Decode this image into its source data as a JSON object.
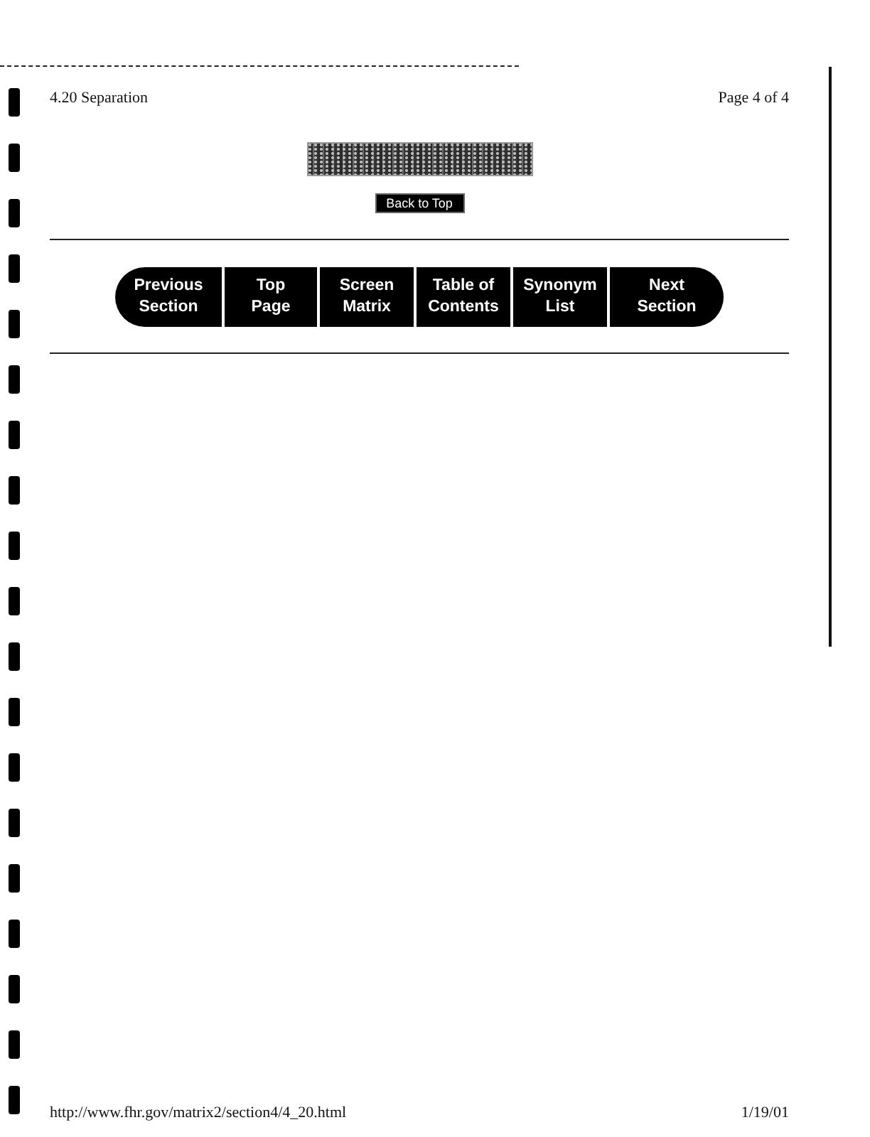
{
  "header": {
    "title": "4.20 Separation",
    "page": "Page 4 of 4"
  },
  "back_to_top": "Back to Top",
  "nav": [
    {
      "lines": [
        "Previous",
        "Section"
      ]
    },
    {
      "lines": [
        "Top",
        "Page"
      ]
    },
    {
      "lines": [
        "Screen",
        "Matrix"
      ]
    },
    {
      "lines": [
        "Table of",
        "Contents"
      ]
    },
    {
      "lines": [
        "Synonym",
        "List"
      ]
    },
    {
      "lines": [
        "Next",
        "Section"
      ]
    }
  ],
  "footer": {
    "url": "http://www.fhr.gov/matrix2/section4/4_20.html",
    "date": "1/19/01"
  }
}
